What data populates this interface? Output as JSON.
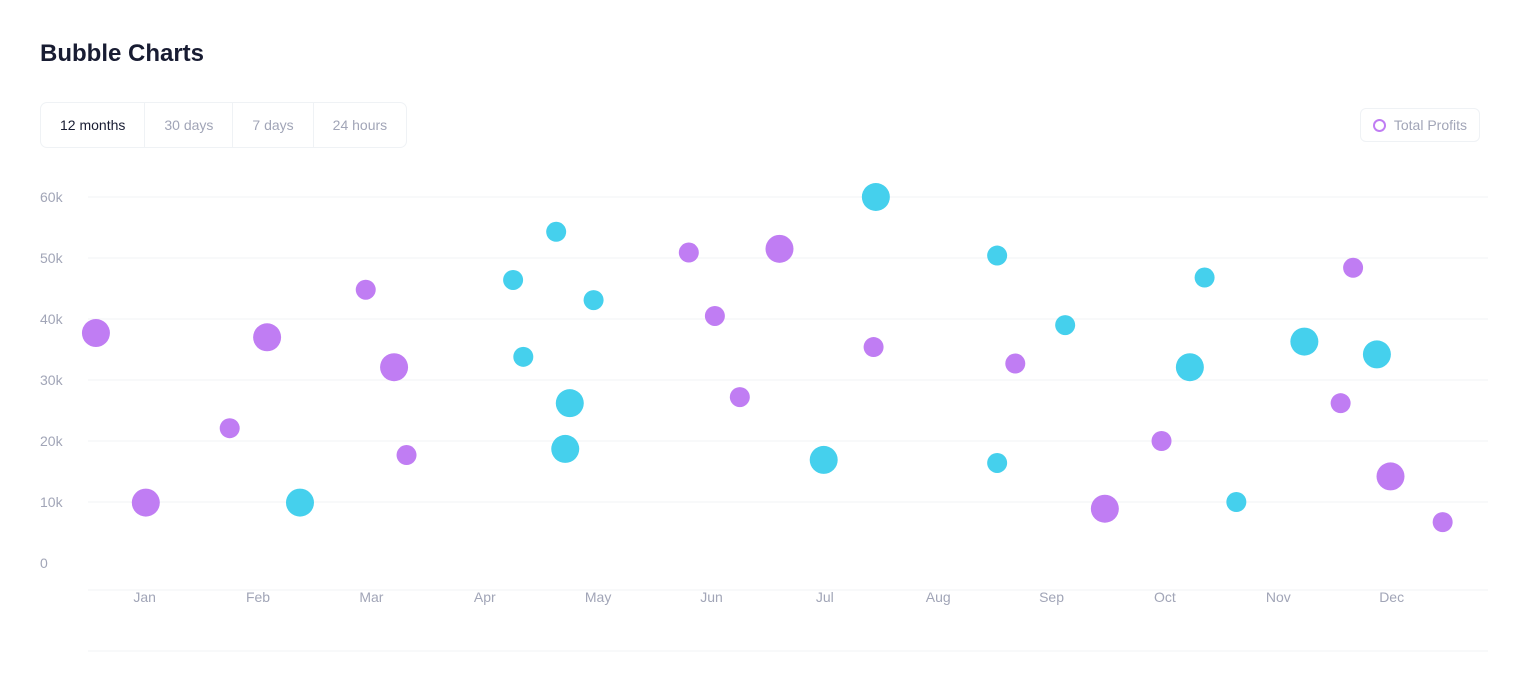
{
  "page": {
    "title": "Bubble Charts"
  },
  "tabs": [
    {
      "label": "12 months",
      "active": true
    },
    {
      "label": "30 days",
      "active": false
    },
    {
      "label": "7 days",
      "active": false
    },
    {
      "label": "24 hours",
      "active": false
    }
  ],
  "legend": {
    "label": "Total Profits",
    "color": "#c07df3"
  },
  "colors": {
    "purple": "#c07df3",
    "cyan": "#45d0ed",
    "grid": "#f1f3f6",
    "tick": "#a1a5b7"
  },
  "chart_data": {
    "type": "scatter",
    "title": "Bubble Charts",
    "xlabel": "",
    "ylabel": "",
    "xticks": [
      "Jan",
      "Feb",
      "Mar",
      "Apr",
      "May",
      "Jun",
      "Jul",
      "Aug",
      "Sep",
      "Oct",
      "Nov",
      "Dec"
    ],
    "xlim": [
      -0.5,
      11.85
    ],
    "yticks": [
      "0",
      "10k",
      "20k",
      "30k",
      "40k",
      "50k",
      "60k"
    ],
    "ylim": [
      0,
      60000
    ],
    "grid": true,
    "legend_position": "top-right",
    "series": [
      {
        "name": "Total Profits",
        "color": "#c07df3",
        "points": [
          {
            "x": -0.43,
            "y": 37700,
            "size": 2
          },
          {
            "x": 0.01,
            "y": 9900,
            "size": 2
          },
          {
            "x": 0.75,
            "y": 22100,
            "size": 1
          },
          {
            "x": 1.08,
            "y": 37000,
            "size": 2
          },
          {
            "x": 1.95,
            "y": 44800,
            "size": 1
          },
          {
            "x": 2.2,
            "y": 32100,
            "size": 2
          },
          {
            "x": 2.31,
            "y": 17700,
            "size": 1
          },
          {
            "x": 4.8,
            "y": 50900,
            "size": 1
          },
          {
            "x": 5.03,
            "y": 40500,
            "size": 1
          },
          {
            "x": 5.25,
            "y": 27200,
            "size": 1
          },
          {
            "x": 5.6,
            "y": 51500,
            "size": 2
          },
          {
            "x": 6.43,
            "y": 35400,
            "size": 1
          },
          {
            "x": 7.68,
            "y": 32700,
            "size": 1
          },
          {
            "x": 8.47,
            "y": 8900,
            "size": 2
          },
          {
            "x": 8.97,
            "y": 20000,
            "size": 1
          },
          {
            "x": 10.55,
            "y": 26200,
            "size": 1
          },
          {
            "x": 10.66,
            "y": 48400,
            "size": 1
          },
          {
            "x": 10.99,
            "y": 14200,
            "size": 2
          },
          {
            "x": 11.45,
            "y": 6700,
            "size": 1
          }
        ]
      },
      {
        "name": "",
        "color": "#45d0ed",
        "points": [
          {
            "x": 1.37,
            "y": 9900,
            "size": 2
          },
          {
            "x": 3.25,
            "y": 46400,
            "size": 1
          },
          {
            "x": 3.34,
            "y": 33800,
            "size": 1
          },
          {
            "x": 3.63,
            "y": 54300,
            "size": 1
          },
          {
            "x": 3.71,
            "y": 18700,
            "size": 2
          },
          {
            "x": 3.75,
            "y": 26200,
            "size": 2
          },
          {
            "x": 3.96,
            "y": 43100,
            "size": 1
          },
          {
            "x": 5.99,
            "y": 16900,
            "size": 2
          },
          {
            "x": 6.45,
            "y": 60000,
            "size": 2
          },
          {
            "x": 7.52,
            "y": 50400,
            "size": 1
          },
          {
            "x": 7.52,
            "y": 16400,
            "size": 1
          },
          {
            "x": 8.12,
            "y": 39000,
            "size": 1
          },
          {
            "x": 9.22,
            "y": 32100,
            "size": 2
          },
          {
            "x": 9.35,
            "y": 46800,
            "size": 1
          },
          {
            "x": 9.63,
            "y": 10000,
            "size": 1
          },
          {
            "x": 10.23,
            "y": 36300,
            "size": 2
          },
          {
            "x": 10.87,
            "y": 34200,
            "size": 2
          }
        ]
      }
    ]
  }
}
